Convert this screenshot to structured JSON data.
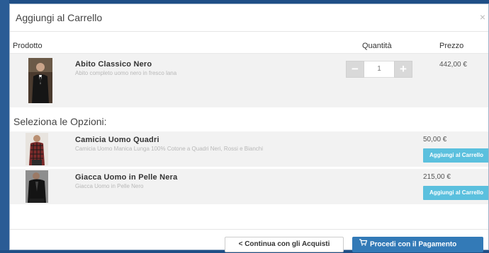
{
  "modal": {
    "title": "Aggiungi al Carrello",
    "close": "×"
  },
  "columns": {
    "product": "Prodotto",
    "quantity": "Quantità",
    "price": "Prezzo"
  },
  "main_product": {
    "name": "Abito Classico Nero",
    "description": "Abito completo uomo nero in fresco lana",
    "quantity": "1",
    "minus": "−",
    "plus": "+",
    "price": "442,00 €"
  },
  "options_title": "Seleziona le Opzioni:",
  "options": [
    {
      "name": "Camicia Uomo Quadri",
      "description": "Camicia Uomo Manica Lunga 100% Cotone a Quadri Neri, Rossi e Bianchi",
      "price": "50,00 €",
      "button": "Aggiungi al Carrello"
    },
    {
      "name": "Giacca Uomo in Pelle Nera",
      "description": "Giacca Uomo in Pelle Nero",
      "price": "215,00 €",
      "button": "Aggiungi al Carrello"
    }
  ],
  "footer": {
    "continue": "< Continua con gli Acquisti",
    "checkout": "Procedi con il Pagamento"
  },
  "icons": {
    "cart": "cart-icon"
  }
}
